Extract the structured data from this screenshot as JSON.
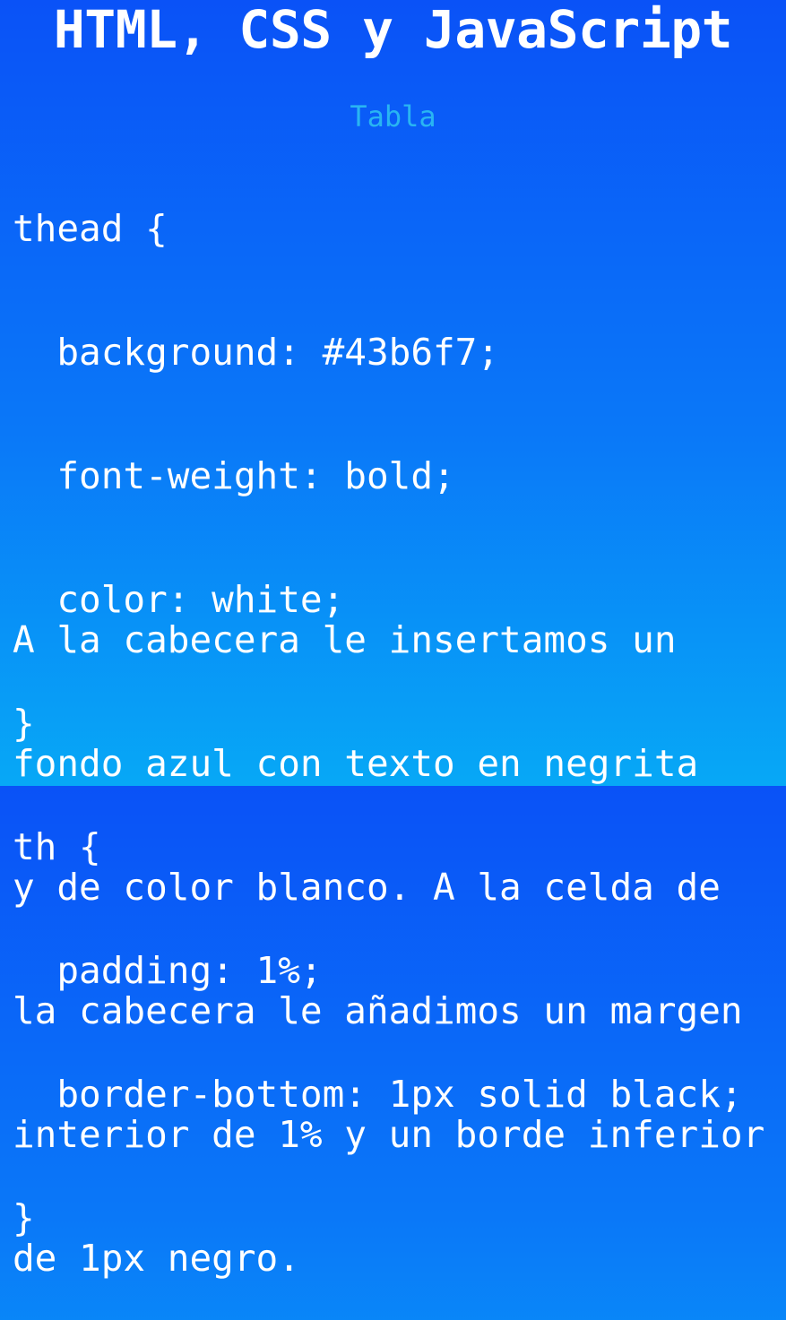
{
  "title": "HTML, CSS y JavaScript",
  "subtitle": "Tabla",
  "code_lines": [
    "thead {",
    "  background: #43b6f7;",
    "  font-weight: bold;",
    "  color: white;",
    "}",
    "th {",
    "  padding: 1%;",
    "  border-bottom: 1px solid black;",
    "}"
  ],
  "description_lines": [
    "A la cabecera le insertamos un",
    "fondo azul con texto en negrita",
    "y de color blanco. A la celda de",
    "la cabecera le añadimos un margen",
    "interior de 1% y un borde inferior",
    "de 1px negro."
  ],
  "colors": {
    "background_top": "#0a52f7",
    "background_bottom": "#07a8f6",
    "subtitle": "#29b5f2",
    "text": "#ffffff"
  }
}
